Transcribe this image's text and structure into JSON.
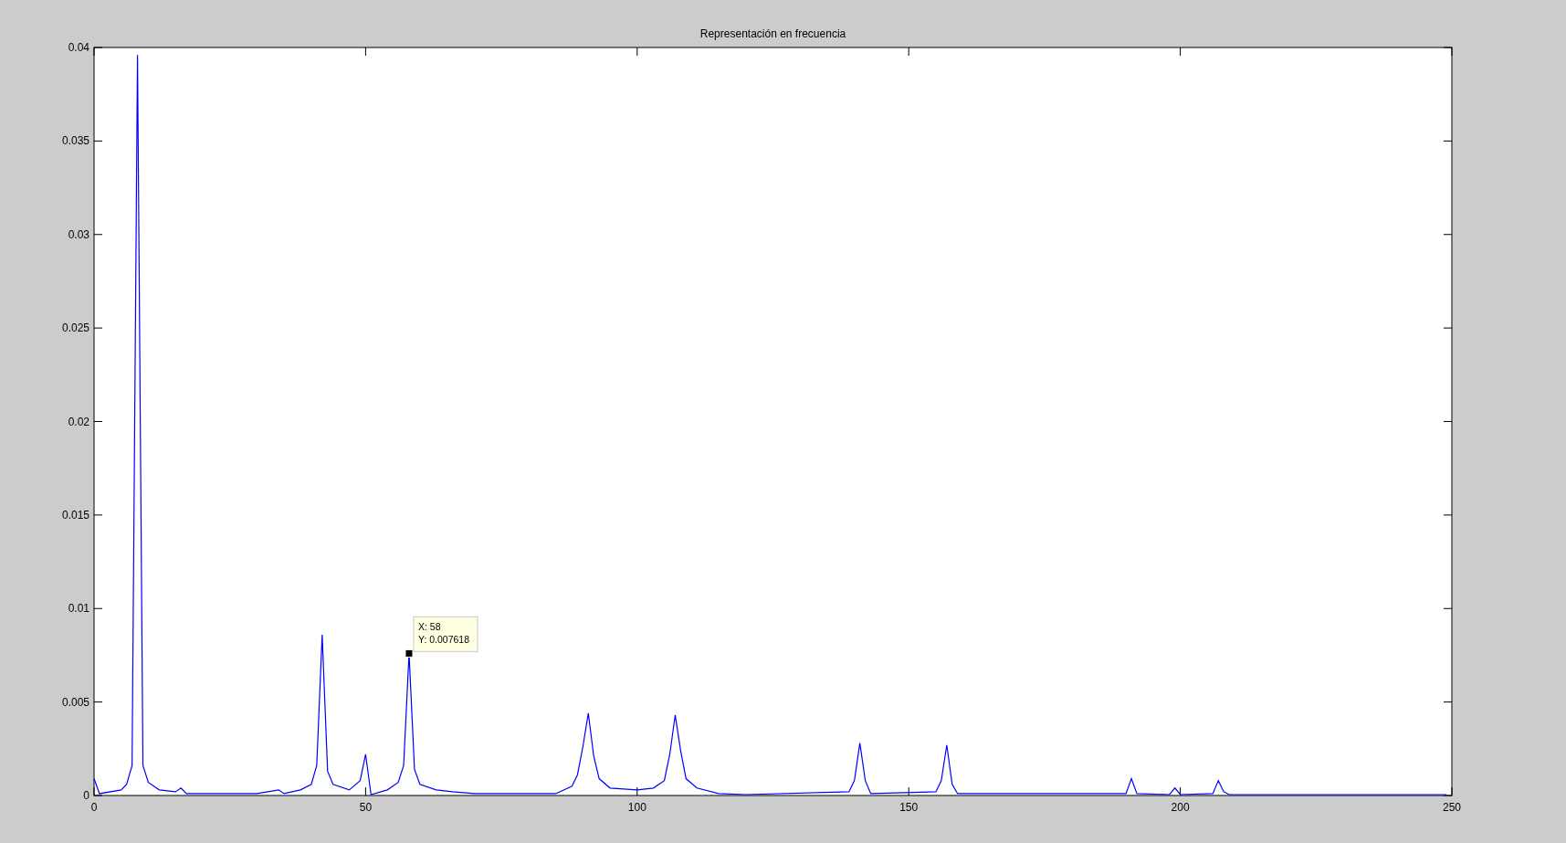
{
  "figure": {
    "chart_data": {
      "type": "line",
      "title": "Representación en frecuencia",
      "xlim": [
        0,
        250
      ],
      "ylim": [
        0,
        0.04
      ],
      "xticks": [
        0,
        50,
        100,
        150,
        200,
        250
      ],
      "yticks": [
        0,
        0.005,
        0.01,
        0.015,
        0.02,
        0.025,
        0.03,
        0.035,
        0.04
      ],
      "x": [
        0,
        1,
        5,
        6,
        7,
        8,
        9,
        10,
        12,
        15,
        16,
        17,
        30,
        34,
        35,
        38,
        40,
        41,
        42,
        43,
        44,
        47,
        49,
        50,
        51,
        54,
        56,
        57,
        58,
        59,
        60,
        63,
        66,
        70,
        85,
        88,
        89,
        90,
        91,
        92,
        93,
        95,
        100,
        103,
        105,
        106,
        107,
        108,
        109,
        111,
        115,
        120,
        139,
        140,
        141,
        142,
        143,
        155,
        156,
        157,
        158,
        159,
        190,
        191,
        192,
        198,
        199,
        200,
        206,
        207,
        208,
        209,
        249
      ],
      "series": [
        {
          "color": "#0000ff",
          "values": [
            0.0009,
            0.0001,
            0.0003,
            0.0006,
            0.0016,
            0.0396,
            0.0016,
            0.0007,
            0.0003,
            0.0002,
            0.0004,
            0.0001,
            0.0001,
            0.0003,
            0.0001,
            0.0003,
            0.0006,
            0.0016,
            0.0086,
            0.0013,
            0.0006,
            0.0003,
            0.0008,
            0.0022,
            5e-05,
            0.0003,
            0.0007,
            0.0016,
            0.0076,
            0.0014,
            0.0006,
            0.0003,
            0.0002,
            0.0001,
            0.0001,
            0.0005,
            0.0011,
            0.0026,
            0.0044,
            0.0021,
            0.0009,
            0.0004,
            0.0003,
            0.0004,
            0.0008,
            0.0022,
            0.0043,
            0.0024,
            0.0009,
            0.0004,
            0.0001,
            5e-05,
            0.0002,
            0.0008,
            0.0028,
            0.0008,
            0.0001,
            0.0002,
            0.0008,
            0.0027,
            0.0006,
            0.0001,
            0.0001,
            0.0009,
            0.0001,
            5e-05,
            0.0004,
            5e-05,
            0.0001,
            0.0008,
            0.0002,
            5e-05,
            5e-05
          ]
        }
      ],
      "annotations": [
        {
          "x": 58,
          "y": 0.0076,
          "text": "X: 58\nY: 0.007618"
        }
      ]
    }
  }
}
